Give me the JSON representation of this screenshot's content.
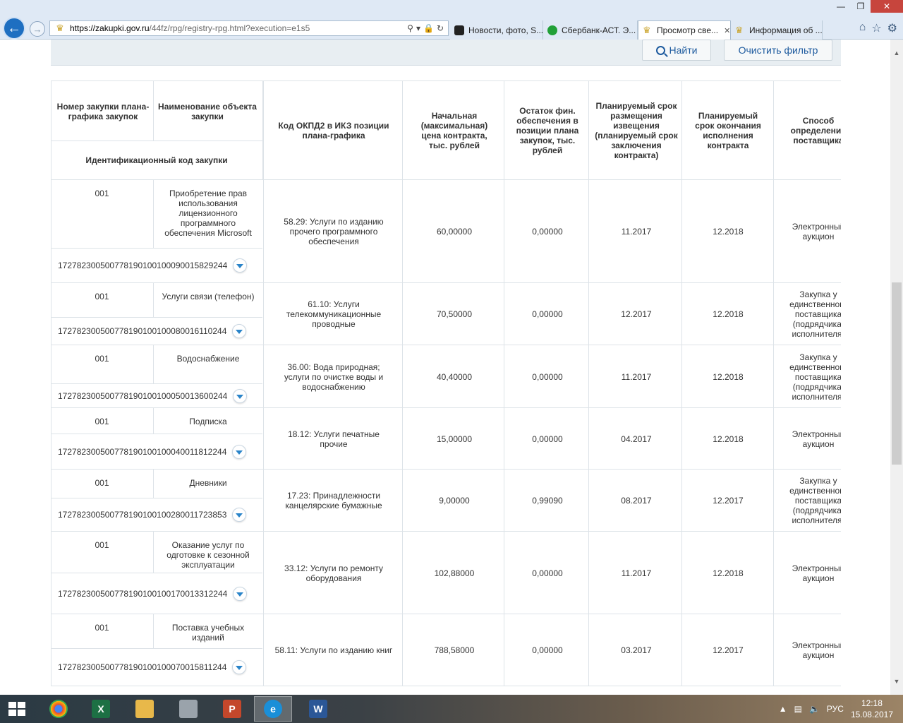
{
  "browser": {
    "url_domain": "https://zakupki.gov.ru",
    "url_rest": "/44fz/rpg/registry-rpg.html?execution=e1s5",
    "tabs": [
      {
        "label": "Новости, фото, S...",
        "active": false,
        "color": "#222222"
      },
      {
        "label": "Сбербанк-АСТ. Э...",
        "active": false,
        "color": "#21a038"
      },
      {
        "label": "Просмотр све...",
        "active": true,
        "color": "#c9a227"
      },
      {
        "label": "Информация об ...",
        "active": false,
        "color": "#c9a227"
      }
    ]
  },
  "filter": {
    "find_label": "Найти",
    "clear_label": "Очистить фильтр"
  },
  "table": {
    "headers": {
      "number": "Номер закупки плана-графика закупок",
      "name": "Наименование объекта закупки",
      "ikz": "Идентификационный код закупки",
      "okpd": "Код ОКПД2 в ИКЗ позиции плана-графика",
      "price": "Начальная (максимальная) цена контракта, тыс. рублей",
      "remain": "Остаток фин. обеспечения в позиции плана закупок, тыс. рублей",
      "placement": "Планируемый срок размещения извещения (планируемый срок заключения контракта)",
      "end": "Планируемый срок окончания исполнения контракта",
      "method": "Способ определения поставщика"
    },
    "rows": [
      {
        "num": "001",
        "name": "Приобретение прав использования лицензионного программного обеспечения Microsoft",
        "ikz": "172782300500778190100100090015829244",
        "okpd": "58.29: Услуги по изданию прочего программного обеспечения",
        "price": "60,00000",
        "remain": "0,00000",
        "placement": "11.2017",
        "end": "12.2018",
        "method": "Электронный аукцион"
      },
      {
        "num": "001",
        "name": "Услуги связи (телефон)",
        "ikz": "172782300500778190100100080016110244",
        "okpd": "61.10: Услуги телекоммуникационные проводные",
        "price": "70,50000",
        "remain": "0,00000",
        "placement": "12.2017",
        "end": "12.2018",
        "method": "Закупка у единственного поставщика (подрядчика, исполнителя)"
      },
      {
        "num": "001",
        "name": "Водоснабжение",
        "ikz": "172782300500778190100100050013600244",
        "okpd": "36.00: Вода природная; услуги по очистке воды и водоснабжению",
        "price": "40,40000",
        "remain": "0,00000",
        "placement": "11.2017",
        "end": "12.2018",
        "method": "Закупка у единственного поставщика (подрядчика, исполнителя)"
      },
      {
        "num": "001",
        "name": "Подписка",
        "ikz": "172782300500778190100100040011812244",
        "okpd": "18.12: Услуги печатные прочие",
        "price": "15,00000",
        "remain": "0,00000",
        "placement": "04.2017",
        "end": "12.2018",
        "method": "Электронный аукцион"
      },
      {
        "num": "001",
        "name": "Дневники",
        "ikz": "172782300500778190100100280011723853",
        "okpd": "17.23: Принадлежности канцелярские бумажные",
        "price": "9,00000",
        "remain": "0,99090",
        "placement": "08.2017",
        "end": "12.2017",
        "method": "Закупка у единственного поставщика (подрядчика, исполнителя)"
      },
      {
        "num": "001",
        "name": "Оказание услуг по одготовке к сезонной эксплуатации",
        "ikz": "172782300500778190100100170013312244",
        "okpd": "33.12: Услуги по ремонту оборудования",
        "price": "102,88000",
        "remain": "0,00000",
        "placement": "11.2017",
        "end": "12.2018",
        "method": "Электронный аукцион"
      },
      {
        "num": "001",
        "name": "Поставка учебных изданий",
        "ikz": "172782300500778190100100070015811244",
        "okpd": "58.11: Услуги по изданию книг",
        "price": "788,58000",
        "remain": "0,00000",
        "placement": "03.2017",
        "end": "12.2017",
        "method": "Электронный аукцион"
      }
    ]
  },
  "taskbar": {
    "lang": "РУС",
    "time": "12:18",
    "date": "15.08.2017"
  }
}
